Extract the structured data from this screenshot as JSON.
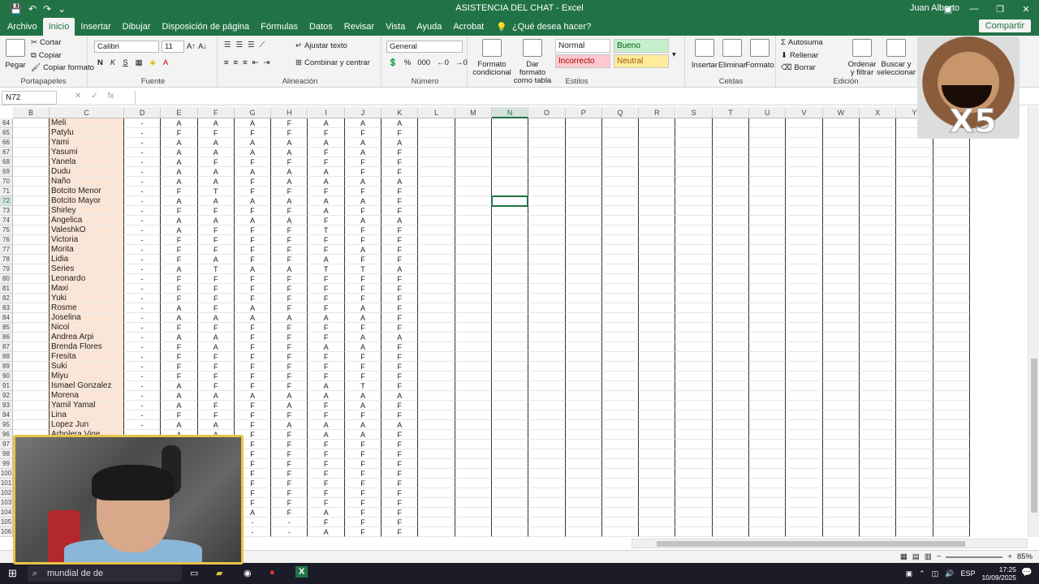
{
  "window": {
    "title": "ASISTENCIA DEL CHAT  -  Excel",
    "user": "Juan Alberto",
    "share": "Compartir"
  },
  "tabs": [
    "Archivo",
    "Inicio",
    "Insertar",
    "Dibujar",
    "Disposición de página",
    "Fórmulas",
    "Datos",
    "Revisar",
    "Vista",
    "Ayuda",
    "Acrobat"
  ],
  "active_tab": "Inicio",
  "tell_me": "¿Qué desea hacer?",
  "ribbon": {
    "clipboard": {
      "paste": "Pegar",
      "cut": "Cortar",
      "copy": "Copiar",
      "format_painter": "Copiar formato",
      "label": "Portapapeles"
    },
    "font": {
      "name": "Calibri",
      "size": "11",
      "bold": "N",
      "italic": "K",
      "underline": "S",
      "label": "Fuente"
    },
    "alignment": {
      "wrap": "Ajustar texto",
      "merge": "Combinar y centrar",
      "label": "Alineación"
    },
    "number": {
      "format": "General",
      "label": "Número"
    },
    "styles": {
      "cond": "Formato condicional",
      "table": "Dar formato como tabla",
      "normal": "Normal",
      "good": "Bueno",
      "bad": "Incorrecto",
      "neutral": "Neutral",
      "label": "Estilos"
    },
    "cells": {
      "insert": "Insertar",
      "delete": "Eliminar",
      "format": "Formato",
      "label": "Celdas"
    },
    "editing": {
      "autosum": "Autosuma",
      "fill": "Rellenar",
      "clear": "Borrar",
      "sort": "Ordenar y filtrar",
      "find": "Buscar y seleccionar",
      "label": "Edición"
    }
  },
  "formula_bar": {
    "name_box": "N72",
    "fx": "fx",
    "value": ""
  },
  "columns": [
    "B",
    "C",
    "D",
    "E",
    "F",
    "G",
    "H",
    "I",
    "J",
    "K",
    "L",
    "M",
    "N",
    "O",
    "P",
    "Q",
    "R",
    "S",
    "T",
    "U",
    "V",
    "W",
    "X",
    "Y",
    "Z"
  ],
  "selected_column": "N",
  "selected_row": "72",
  "rows": [
    {
      "n": "64",
      "name": "Meli",
      "d": "-",
      "v": [
        "A",
        "A",
        "A",
        "F",
        "A",
        "A",
        "A"
      ]
    },
    {
      "n": "65",
      "name": "Patylu",
      "d": "-",
      "v": [
        "F",
        "F",
        "F",
        "F",
        "F",
        "F",
        "F"
      ]
    },
    {
      "n": "66",
      "name": "Yami",
      "d": "-",
      "v": [
        "A",
        "A",
        "A",
        "A",
        "A",
        "A",
        "A"
      ]
    },
    {
      "n": "67",
      "name": "Yasumi",
      "d": "-",
      "v": [
        "A",
        "A",
        "A",
        "A",
        "F",
        "A",
        "F"
      ]
    },
    {
      "n": "68",
      "name": "Yanela",
      "d": "-",
      "v": [
        "A",
        "F",
        "F",
        "F",
        "F",
        "F",
        "F"
      ]
    },
    {
      "n": "69",
      "name": "Dudu",
      "d": "-",
      "v": [
        "A",
        "A",
        "A",
        "A",
        "A",
        "F",
        "F"
      ]
    },
    {
      "n": "70",
      "name": "Ñaño",
      "d": "-",
      "v": [
        "A",
        "A",
        "F",
        "A",
        "A",
        "A",
        "A"
      ]
    },
    {
      "n": "71",
      "name": "Botcito Menor",
      "d": "-",
      "v": [
        "F",
        "T",
        "F",
        "F",
        "F",
        "F",
        "F"
      ]
    },
    {
      "n": "72",
      "name": "Botcito Mayor",
      "d": "-",
      "v": [
        "A",
        "A",
        "A",
        "A",
        "A",
        "A",
        "F"
      ]
    },
    {
      "n": "73",
      "name": "Shirley",
      "d": "-",
      "v": [
        "F",
        "F",
        "F",
        "F",
        "A",
        "F",
        "F"
      ]
    },
    {
      "n": "74",
      "name": "Angelica",
      "d": "-",
      "v": [
        "A",
        "A",
        "A",
        "A",
        "F",
        "A",
        "A"
      ]
    },
    {
      "n": "75",
      "name": "ValeshkO",
      "d": "-",
      "v": [
        "A",
        "F",
        "F",
        "F",
        "T",
        "F",
        "F"
      ]
    },
    {
      "n": "76",
      "name": "Victoria",
      "d": "-",
      "v": [
        "F",
        "F",
        "F",
        "F",
        "F",
        "F",
        "F"
      ]
    },
    {
      "n": "77",
      "name": "Morita",
      "d": "-",
      "v": [
        "F",
        "F",
        "F",
        "F",
        "F",
        "A",
        "F"
      ]
    },
    {
      "n": "78",
      "name": "Lidia",
      "d": "-",
      "v": [
        "F",
        "A",
        "F",
        "F",
        "A",
        "F",
        "F"
      ]
    },
    {
      "n": "79",
      "name": "Series",
      "d": "-",
      "v": [
        "A",
        "T",
        "A",
        "A",
        "T",
        "T",
        "A"
      ]
    },
    {
      "n": "80",
      "name": "Leonardo",
      "d": "-",
      "v": [
        "F",
        "F",
        "F",
        "F",
        "F",
        "F",
        "F"
      ]
    },
    {
      "n": "81",
      "name": "Maxi",
      "d": "-",
      "v": [
        "F",
        "F",
        "F",
        "F",
        "F",
        "F",
        "F"
      ]
    },
    {
      "n": "82",
      "name": "Yuki",
      "d": "-",
      "v": [
        "F",
        "F",
        "F",
        "F",
        "F",
        "F",
        "F"
      ]
    },
    {
      "n": "83",
      "name": "Rosme",
      "d": "-",
      "v": [
        "A",
        "F",
        "A",
        "F",
        "F",
        "A",
        "F"
      ]
    },
    {
      "n": "84",
      "name": "Joselina",
      "d": "-",
      "v": [
        "A",
        "A",
        "A",
        "A",
        "A",
        "A",
        "F"
      ]
    },
    {
      "n": "85",
      "name": "Nicol",
      "d": "-",
      "v": [
        "F",
        "F",
        "F",
        "F",
        "F",
        "F",
        "F"
      ]
    },
    {
      "n": "86",
      "name": "Andrea Arpi",
      "d": "-",
      "v": [
        "A",
        "A",
        "F",
        "F",
        "F",
        "A",
        "A"
      ]
    },
    {
      "n": "87",
      "name": "Brenda Flores",
      "d": "-",
      "v": [
        "F",
        "A",
        "F",
        "F",
        "A",
        "A",
        "F"
      ]
    },
    {
      "n": "88",
      "name": "Fresita",
      "d": "-",
      "v": [
        "F",
        "F",
        "F",
        "F",
        "F",
        "F",
        "F"
      ]
    },
    {
      "n": "89",
      "name": "Suki",
      "d": "-",
      "v": [
        "F",
        "F",
        "F",
        "F",
        "F",
        "F",
        "F"
      ]
    },
    {
      "n": "90",
      "name": "Miyu",
      "d": "-",
      "v": [
        "F",
        "F",
        "F",
        "F",
        "F",
        "F",
        "F"
      ]
    },
    {
      "n": "91",
      "name": "Ismael Gonzalez",
      "d": "-",
      "v": [
        "A",
        "F",
        "F",
        "F",
        "A",
        "T",
        "F"
      ]
    },
    {
      "n": "92",
      "name": "Morena",
      "d": "-",
      "v": [
        "A",
        "A",
        "A",
        "A",
        "A",
        "A",
        "A"
      ]
    },
    {
      "n": "93",
      "name": "Yamil Yamal",
      "d": "-",
      "v": [
        "A",
        "F",
        "F",
        "A",
        "F",
        "A",
        "F"
      ]
    },
    {
      "n": "94",
      "name": "Lina",
      "d": "-",
      "v": [
        "F",
        "F",
        "F",
        "F",
        "F",
        "F",
        "F"
      ]
    },
    {
      "n": "95",
      "name": "Lopez Jun",
      "d": "-",
      "v": [
        "A",
        "A",
        "F",
        "A",
        "A",
        "A",
        "A"
      ]
    },
    {
      "n": "96",
      "name": "Arbolera Vige",
      "d": "",
      "v": [
        "A",
        "A",
        "F",
        "F",
        "A",
        "A",
        "F"
      ]
    },
    {
      "n": "97",
      "name": "",
      "d": "",
      "v": [
        "",
        "",
        "F",
        "F",
        "F",
        "F",
        "F"
      ]
    },
    {
      "n": "98",
      "name": "",
      "d": "",
      "v": [
        "",
        "",
        "F",
        "F",
        "F",
        "F",
        "F"
      ]
    },
    {
      "n": "99",
      "name": "",
      "d": "",
      "v": [
        "",
        "",
        "F",
        "F",
        "F",
        "F",
        "F"
      ]
    },
    {
      "n": "100",
      "name": "",
      "d": "",
      "v": [
        "",
        "",
        "F",
        "F",
        "F",
        "F",
        "F"
      ]
    },
    {
      "n": "101",
      "name": "",
      "d": "",
      "v": [
        "",
        "",
        "F",
        "F",
        "F",
        "F",
        "F"
      ]
    },
    {
      "n": "102",
      "name": "",
      "d": "",
      "v": [
        "",
        "",
        "F",
        "F",
        "F",
        "F",
        "F"
      ]
    },
    {
      "n": "103",
      "name": "",
      "d": "",
      "v": [
        "",
        "",
        "F",
        "F",
        "F",
        "F",
        "F"
      ]
    },
    {
      "n": "104",
      "name": "",
      "d": "",
      "v": [
        "",
        "",
        "A",
        "F",
        "A",
        "F",
        "F"
      ]
    },
    {
      "n": "105",
      "name": "",
      "d": "",
      "v": [
        "",
        "",
        "-",
        "-",
        "F",
        "F",
        "F"
      ]
    },
    {
      "n": "106",
      "name": "",
      "d": "",
      "v": [
        "",
        "",
        "-",
        "-",
        "A",
        "F",
        "F"
      ]
    }
  ],
  "status": {
    "zoom": "85%"
  },
  "taskbar": {
    "search": "mundial de de",
    "time": "17:25",
    "date": "10/09/2025",
    "lang": "ESP"
  },
  "overlays": {
    "sticker_text": "X5"
  }
}
